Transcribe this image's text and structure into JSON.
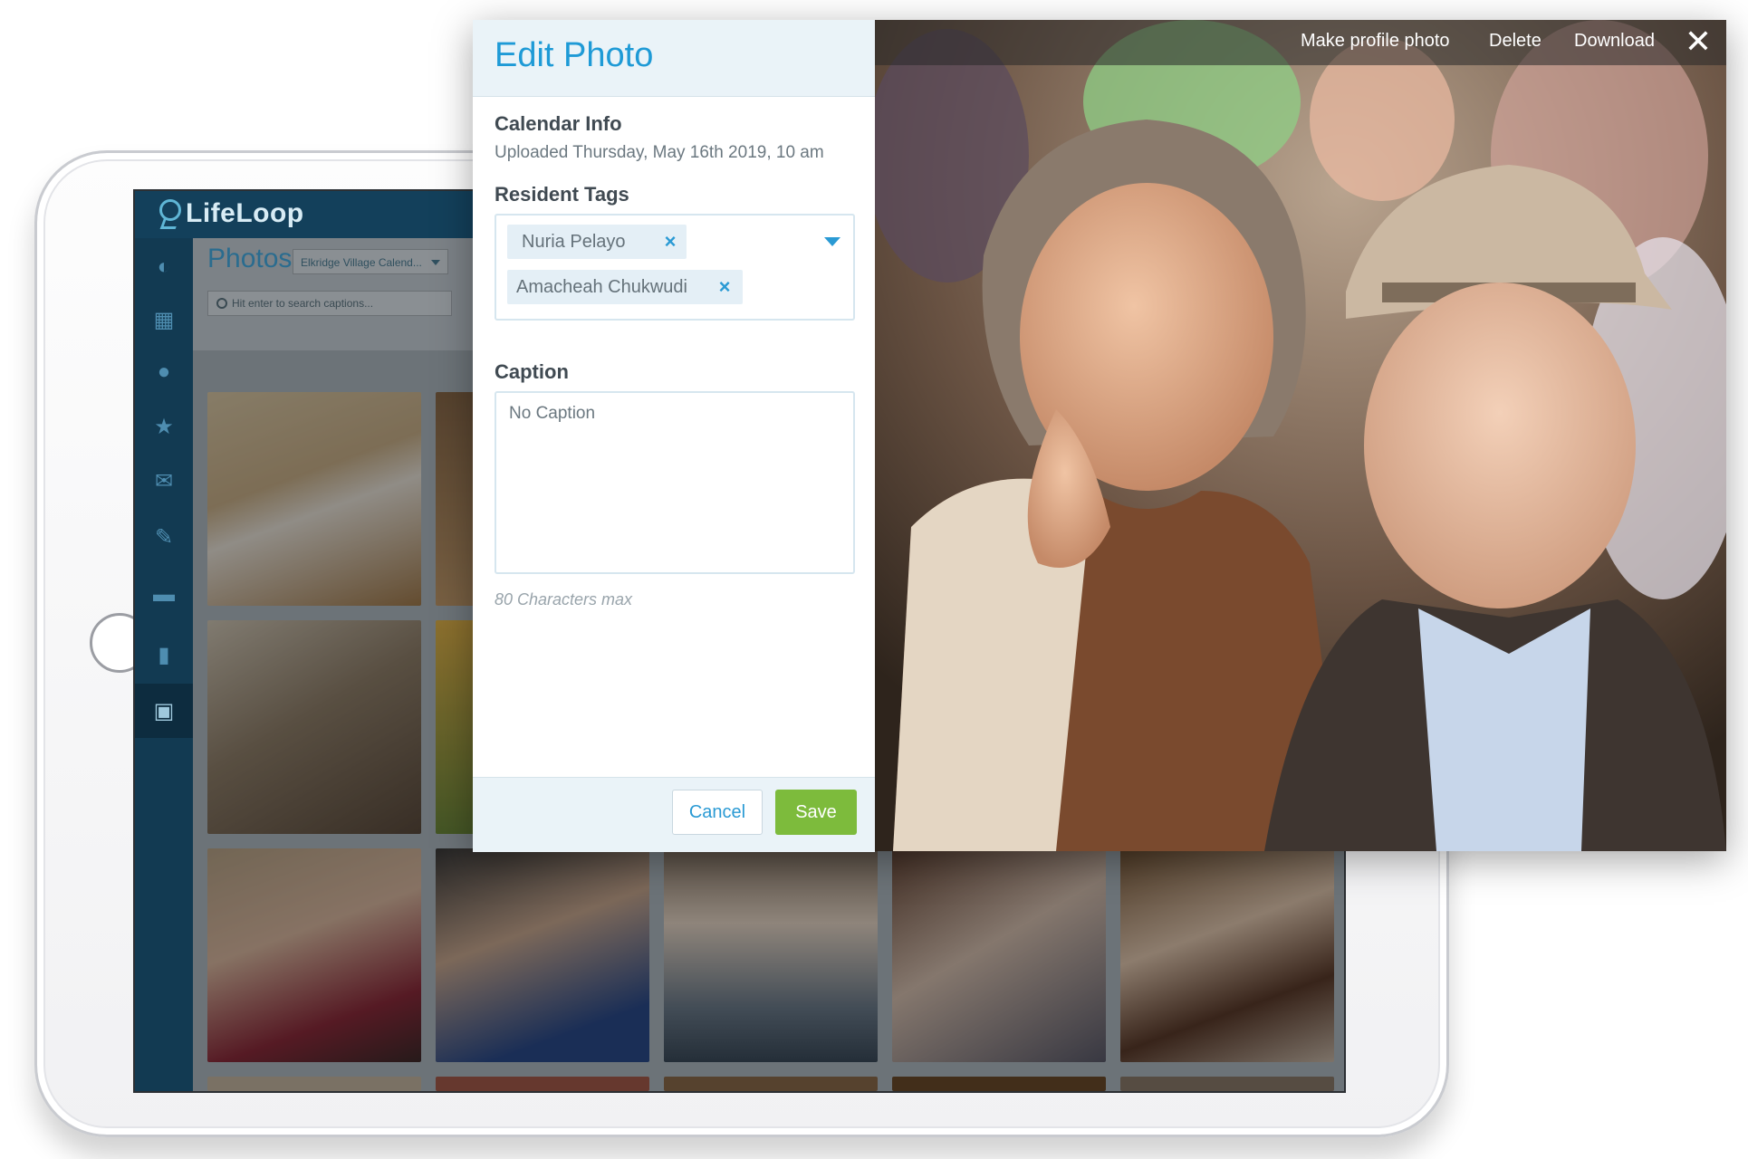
{
  "app": {
    "brand": "LifeLoop",
    "page_title": "Photos",
    "calendar_select": "Elkridge Village Calend...",
    "search_placeholder": "Hit enter to search captions..."
  },
  "sidebar_icons": [
    "dashboard-icon",
    "calendar-icon",
    "residents-icon",
    "star-icon",
    "mail-icon",
    "wrench-icon",
    "car-icon",
    "chart-icon",
    "photo-icon"
  ],
  "dialog": {
    "title": "Edit Photo",
    "calendar_info_label": "Calendar Info",
    "uploaded_text": "Uploaded Thursday, May 16th 2019, 10 am",
    "resident_tags_label": "Resident Tags",
    "tags": [
      {
        "name": "Nuria Pelayo"
      },
      {
        "name": "Amacheah Chukwudi"
      }
    ],
    "remove_glyph": "×",
    "caption_label": "Caption",
    "caption_placeholder": "No Caption",
    "caption_hint": "80 Characters max",
    "cancel_label": "Cancel",
    "save_label": "Save"
  },
  "photo_toolbar": {
    "make_profile": "Make profile photo",
    "delete": "Delete",
    "download": "Download",
    "close_glyph": "✕"
  },
  "colors": {
    "accent_blue": "#1e9ad6",
    "save_green": "#7dbb3c",
    "navy": "#13405b"
  }
}
